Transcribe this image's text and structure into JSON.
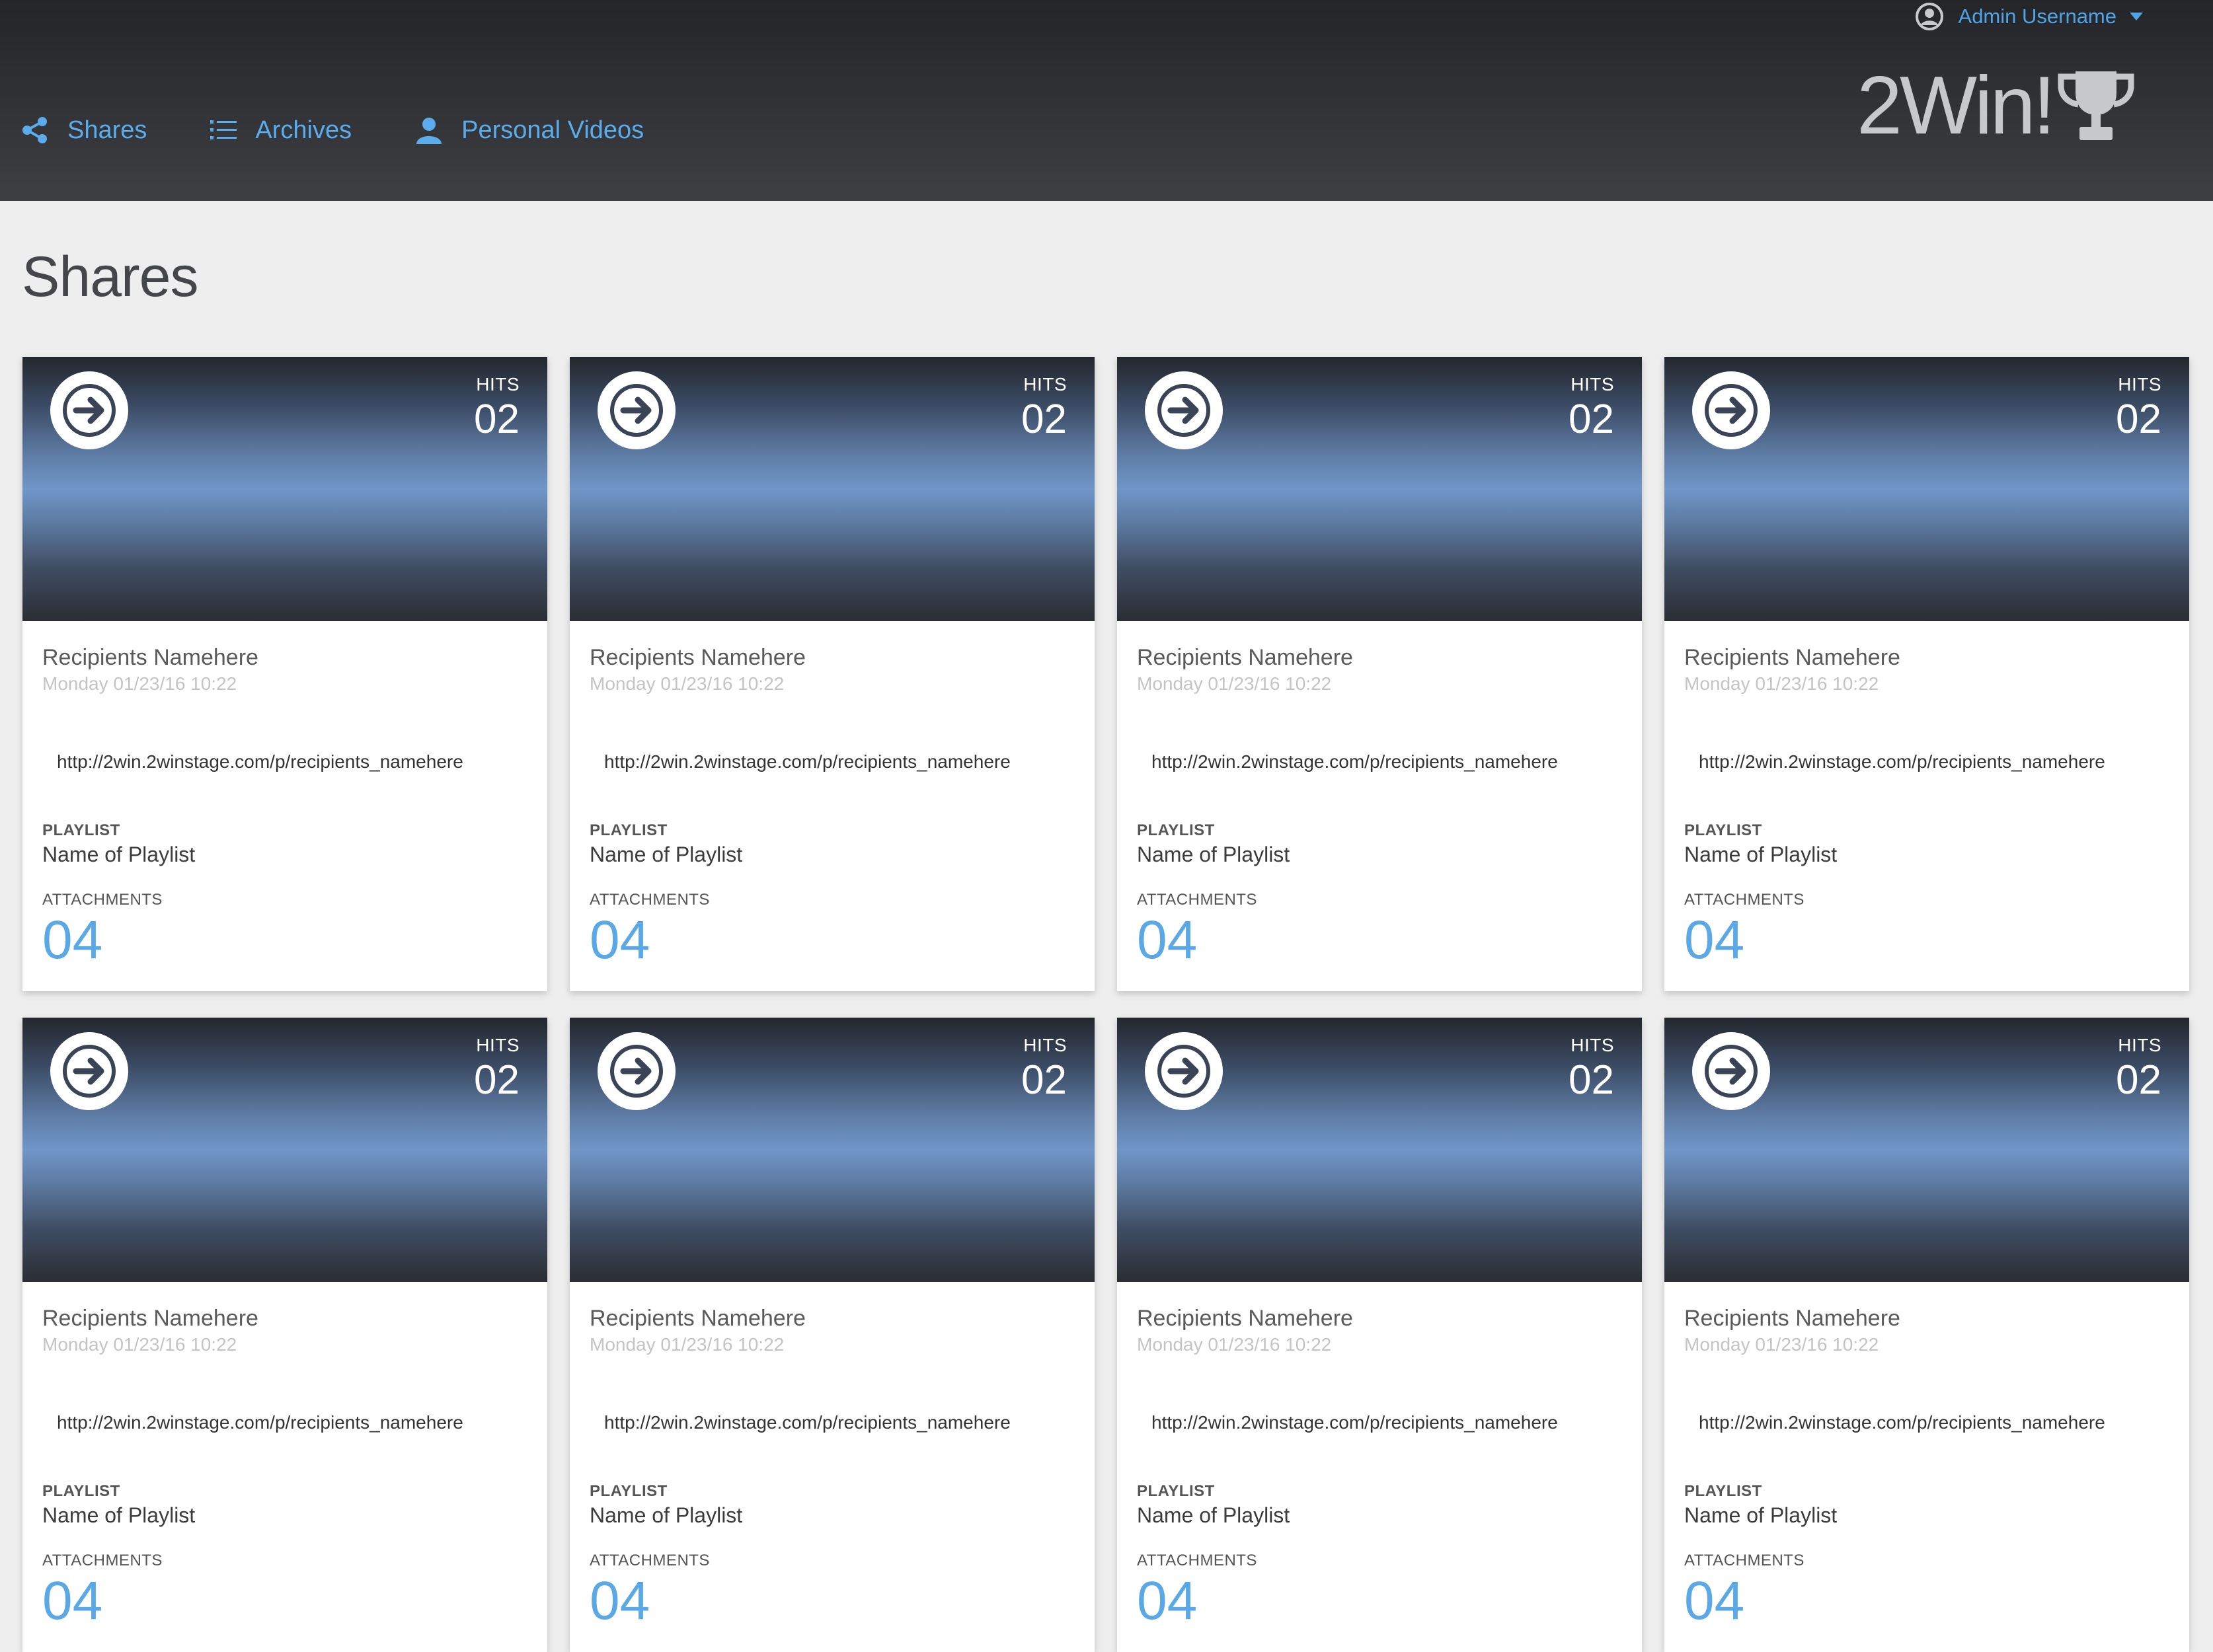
{
  "header": {
    "user": {
      "name": "Admin Username"
    },
    "nav": [
      {
        "label": "Shares",
        "icon": "share-icon"
      },
      {
        "label": "Archives",
        "icon": "list-icon"
      },
      {
        "label": "Personal Videos",
        "icon": "user-icon"
      }
    ],
    "brand": {
      "text": "2Win!",
      "icon": "trophy-icon"
    },
    "accent_color": "#5aacec"
  },
  "page": {
    "title": "Shares"
  },
  "cards": [
    {
      "hits_label": "HITS",
      "hits": "02",
      "recipient": "Recipients Namehere",
      "date": "Monday 01/23/16 10:22",
      "link": "http://2win.2winstage.com/p/recipients_namehere",
      "playlist_label": "PLAYLIST",
      "playlist": "Name of Playlist",
      "attachments_label": "ATTACHMENTS",
      "attachments": "04"
    },
    {
      "hits_label": "HITS",
      "hits": "02",
      "recipient": "Recipients Namehere",
      "date": "Monday 01/23/16 10:22",
      "link": "http://2win.2winstage.com/p/recipients_namehere",
      "playlist_label": "PLAYLIST",
      "playlist": "Name of Playlist",
      "attachments_label": "ATTACHMENTS",
      "attachments": "04"
    },
    {
      "hits_label": "HITS",
      "hits": "02",
      "recipient": "Recipients Namehere",
      "date": "Monday 01/23/16 10:22",
      "link": "http://2win.2winstage.com/p/recipients_namehere",
      "playlist_label": "PLAYLIST",
      "playlist": "Name of Playlist",
      "attachments_label": "ATTACHMENTS",
      "attachments": "04"
    },
    {
      "hits_label": "HITS",
      "hits": "02",
      "recipient": "Recipients Namehere",
      "date": "Monday 01/23/16 10:22",
      "link": "http://2win.2winstage.com/p/recipients_namehere",
      "playlist_label": "PLAYLIST",
      "playlist": "Name of Playlist",
      "attachments_label": "ATTACHMENTS",
      "attachments": "04"
    },
    {
      "hits_label": "HITS",
      "hits": "02",
      "recipient": "Recipients Namehere",
      "date": "Monday 01/23/16 10:22",
      "link": "http://2win.2winstage.com/p/recipients_namehere",
      "playlist_label": "PLAYLIST",
      "playlist": "Name of Playlist",
      "attachments_label": "ATTACHMENTS",
      "attachments": "04"
    },
    {
      "hits_label": "HITS",
      "hits": "02",
      "recipient": "Recipients Namehere",
      "date": "Monday 01/23/16 10:22",
      "link": "http://2win.2winstage.com/p/recipients_namehere",
      "playlist_label": "PLAYLIST",
      "playlist": "Name of Playlist",
      "attachments_label": "ATTACHMENTS",
      "attachments": "04"
    },
    {
      "hits_label": "HITS",
      "hits": "02",
      "recipient": "Recipients Namehere",
      "date": "Monday 01/23/16 10:22",
      "link": "http://2win.2winstage.com/p/recipients_namehere",
      "playlist_label": "PLAYLIST",
      "playlist": "Name of Playlist",
      "attachments_label": "ATTACHMENTS",
      "attachments": "04"
    },
    {
      "hits_label": "HITS",
      "hits": "02",
      "recipient": "Recipients Namehere",
      "date": "Monday 01/23/16 10:22",
      "link": "http://2win.2winstage.com/p/recipients_namehere",
      "playlist_label": "PLAYLIST",
      "playlist": "Name of Playlist",
      "attachments_label": "ATTACHMENTS",
      "attachments": "04"
    }
  ]
}
